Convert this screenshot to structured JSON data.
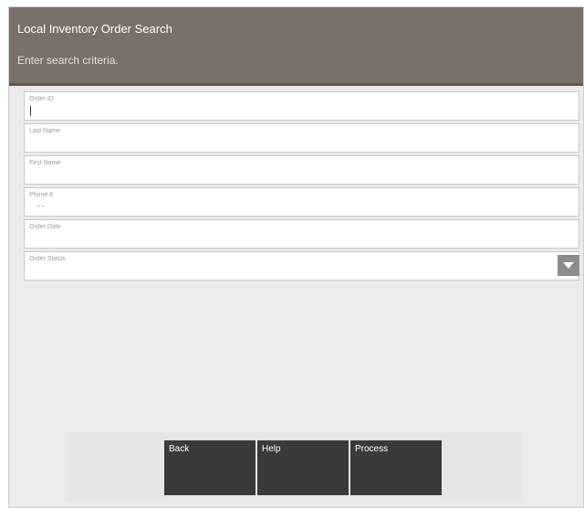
{
  "header": {
    "title": "Local Inventory Order Search",
    "prompt": "Enter search criteria."
  },
  "form": {
    "order_id": {
      "label": "Order ID",
      "value": ""
    },
    "last_name": {
      "label": "Last Name",
      "value": ""
    },
    "first_name": {
      "label": "First Name",
      "value": ""
    },
    "phone": {
      "label": "Phone #",
      "value": "-  -"
    },
    "order_date": {
      "label": "Order Date",
      "value": ""
    },
    "order_status": {
      "label": "Order Status",
      "value": ""
    }
  },
  "buttons": {
    "back": "Back",
    "help": "Help",
    "process": "Process"
  },
  "colors": {
    "header_bg": "#797068",
    "button_bg": "#3a3a3a",
    "dropdown_bg": "#8c8c8c"
  }
}
